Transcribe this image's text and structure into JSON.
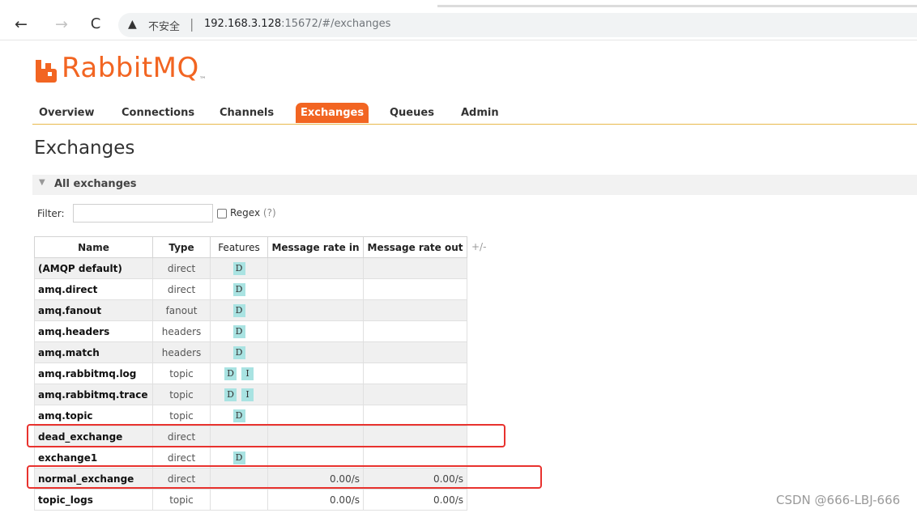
{
  "browser": {
    "back_glyph": "←",
    "forward_glyph": "→",
    "reload_glyph": "C",
    "warning_glyph": "▲",
    "security_text": "不安全",
    "separator": "|",
    "url_host": "192.168.3.128",
    "url_rest": ":15672/#/exchanges"
  },
  "logo": {
    "text": "RabbitMQ",
    "tm": "™",
    "color": "#f26522"
  },
  "nav": {
    "items": [
      {
        "label": "Overview"
      },
      {
        "label": "Connections"
      },
      {
        "label": "Channels"
      },
      {
        "label": "Exchanges",
        "active": true
      },
      {
        "label": "Queues"
      },
      {
        "label": "Admin"
      }
    ]
  },
  "page": {
    "title": "Exchanges"
  },
  "section": {
    "caret": "▼",
    "title": "All exchanges"
  },
  "filter": {
    "label": "Filter:",
    "value": "",
    "regex_label": "Regex",
    "regex_help": "(?)",
    "regex_checked": false
  },
  "table": {
    "columns": [
      "Name",
      "Type",
      "Features",
      "Message rate in",
      "Message rate out"
    ],
    "toggle": "+/-",
    "rows": [
      {
        "name": "(AMQP default)",
        "type": "direct",
        "features": [
          "D"
        ],
        "rate_in": "",
        "rate_out": ""
      },
      {
        "name": "amq.direct",
        "type": "direct",
        "features": [
          "D"
        ],
        "rate_in": "",
        "rate_out": ""
      },
      {
        "name": "amq.fanout",
        "type": "fanout",
        "features": [
          "D"
        ],
        "rate_in": "",
        "rate_out": ""
      },
      {
        "name": "amq.headers",
        "type": "headers",
        "features": [
          "D"
        ],
        "rate_in": "",
        "rate_out": ""
      },
      {
        "name": "amq.match",
        "type": "headers",
        "features": [
          "D"
        ],
        "rate_in": "",
        "rate_out": ""
      },
      {
        "name": "amq.rabbitmq.log",
        "type": "topic",
        "features": [
          "D",
          "I"
        ],
        "rate_in": "",
        "rate_out": ""
      },
      {
        "name": "amq.rabbitmq.trace",
        "type": "topic",
        "features": [
          "D",
          "I"
        ],
        "rate_in": "",
        "rate_out": ""
      },
      {
        "name": "amq.topic",
        "type": "topic",
        "features": [
          "D"
        ],
        "rate_in": "",
        "rate_out": ""
      },
      {
        "name": "dead_exchange",
        "type": "direct",
        "features": [],
        "rate_in": "",
        "rate_out": ""
      },
      {
        "name": "exchange1",
        "type": "direct",
        "features": [
          "D"
        ],
        "rate_in": "",
        "rate_out": ""
      },
      {
        "name": "normal_exchange",
        "type": "direct",
        "features": [],
        "rate_in": "0.00/s",
        "rate_out": "0.00/s"
      },
      {
        "name": "topic_logs",
        "type": "topic",
        "features": [],
        "rate_in": "0.00/s",
        "rate_out": "0.00/s"
      }
    ]
  },
  "highlight_color": "#e8322e",
  "watermark": "CSDN @666-LBJ-666"
}
